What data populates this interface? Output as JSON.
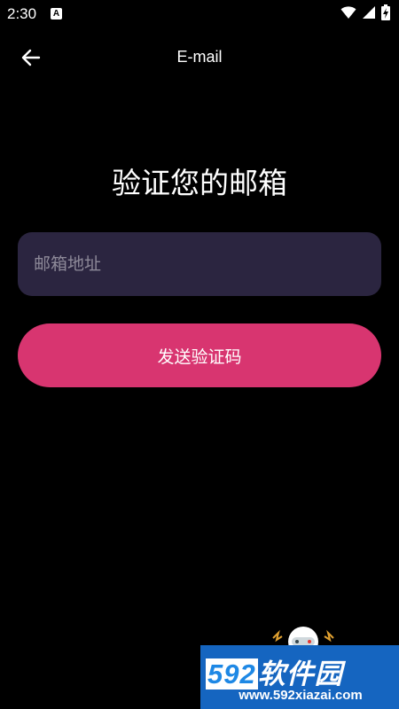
{
  "status_bar": {
    "time": "2:30",
    "notification_icon": "A",
    "icons": [
      "wifi-icon",
      "signal-icon",
      "battery-charging-icon"
    ]
  },
  "app_bar": {
    "back_icon": "arrow-left-icon",
    "title": "E-mail"
  },
  "main": {
    "heading": "验证您的邮箱",
    "email_input": {
      "placeholder": "邮箱地址",
      "value": ""
    },
    "send_button_label": "发送验证码"
  },
  "watermark": {
    "logo_number": "592",
    "logo_text": "软件园",
    "url": "www.592xiazai.com"
  },
  "colors": {
    "background": "#000000",
    "input_background": "#2b2540",
    "accent": "#d83570",
    "text": "#ffffff",
    "placeholder": "#8e8a99",
    "watermark_blue": "#1565c0"
  }
}
